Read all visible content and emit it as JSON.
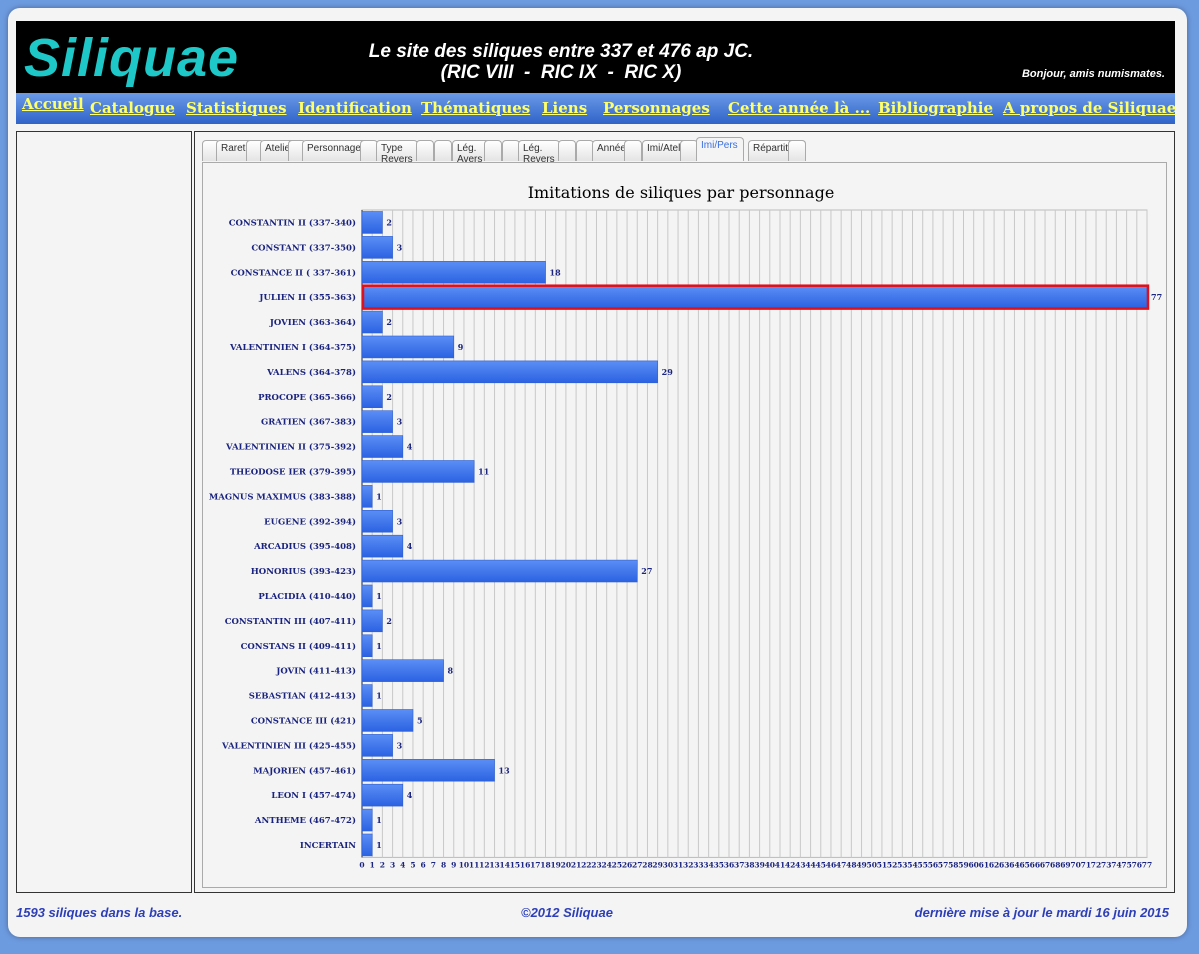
{
  "header": {
    "logo": "Siliquae",
    "tagline_line1": "Le site des siliques entre 337 et 476 ap JC.",
    "tagline_line2": "(RIC VIII  -  RIC IX  -  RIC X)",
    "greeting": "Bonjour, amis numismates."
  },
  "nav": {
    "items": [
      "Accueil",
      "Catalogue",
      "Statistiques",
      "Identification",
      "Thématiques",
      "Liens",
      "Personnages",
      "Cette année là ...",
      "Bibliographie",
      "A propos de Siliquae"
    ]
  },
  "tabs": {
    "items": [
      "Rareté",
      "Atelier",
      "Personnage",
      "Type\nRevers",
      "Lég.\nAvers",
      "Lég.\nRevers",
      "Années",
      "Imi/Atel.",
      "Imi/Pers",
      "Répartition"
    ],
    "selected": "Imi/Pers"
  },
  "chart_data": {
    "type": "bar",
    "orientation": "horizontal",
    "title": "Imitations de siliques par personnage",
    "categories": [
      "CONSTANTIN II (337-340)",
      "CONSTANT (337-350)",
      "CONSTANCE II ( 337-361)",
      "JULIEN II (355-363)",
      "JOVIEN (363-364)",
      "VALENTINIEN I (364-375)",
      "VALENS (364-378)",
      "PROCOPE (365-366)",
      "GRATIEN (367-383)",
      "VALENTINIEN II (375-392)",
      "THEODOSE IER (379-395)",
      "MAGNUS MAXIMUS (383-388)",
      "EUGENE (392-394)",
      "ARCADIUS (395-408)",
      "HONORIUS (393-423)",
      "PLACIDIA (410-440)",
      "CONSTANTIN III (407-411)",
      "CONSTANS II (409-411)",
      "JOVIN (411-413)",
      "SEBASTIAN (412-413)",
      "CONSTANCE III (421)",
      "VALENTINIEN III (425-455)",
      "MAJORIEN (457-461)",
      "LEON I (457-474)",
      "ANTHEME (467-472)",
      "INCERTAIN"
    ],
    "values": [
      2,
      3,
      18,
      77,
      2,
      9,
      29,
      2,
      3,
      4,
      11,
      1,
      3,
      4,
      27,
      1,
      2,
      1,
      8,
      1,
      5,
      3,
      13,
      4,
      1,
      1
    ],
    "xlim": [
      0,
      77
    ],
    "grid": true,
    "highlighted_category": "JULIEN II (355-363)",
    "bar_color": "#3a74f0",
    "highlight_color": "#e0101a"
  },
  "footer": {
    "count": "1593 siliques dans la base.",
    "copyright": "©2012 Siliquae",
    "updated": "dernière mise à jour le mardi 16 juin 2015"
  }
}
